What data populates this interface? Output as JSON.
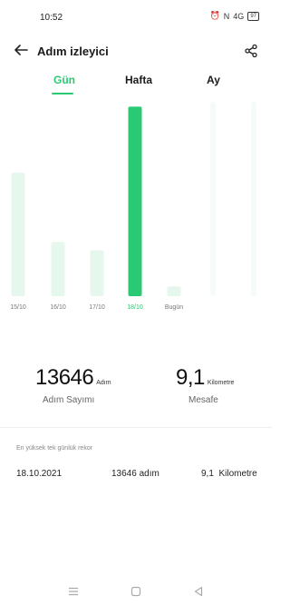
{
  "status_bar": {
    "time": "10:52",
    "battery": "97",
    "network": "N",
    "signal": "4G"
  },
  "header": {
    "title": "Adım izleyici",
    "back_icon": "arrow-left-icon",
    "share_icon": "share-icon"
  },
  "tabs": [
    {
      "label": "Gün",
      "active": true
    },
    {
      "label": "Hafta",
      "active": false
    },
    {
      "label": "Ay",
      "active": false
    }
  ],
  "colors": {
    "accent": "#2bc973",
    "bar_light": "#e6f7ed",
    "bar_faint": "#f6fbf8"
  },
  "chart_data": {
    "type": "bar",
    "categories": [
      "15/10",
      "16/10",
      "17/10",
      "18/10",
      "Bugün"
    ],
    "values": [
      8900,
      3900,
      3300,
      13646,
      700
    ],
    "highlight_index": 3,
    "ylim": [
      0,
      14000
    ]
  },
  "stats": {
    "steps_value": "13646",
    "steps_unit": "Adım",
    "steps_label": "Adım Sayımı",
    "distance_value": "9,1",
    "distance_unit": "Kilometre",
    "distance_label": "Mesafe"
  },
  "record": {
    "heading": "En yüksek tek günlük rekor",
    "date": "18.10.2021",
    "steps": "13646 adım",
    "distance": "9,1  Kilometre"
  },
  "nav_bar": {
    "menu_icon": "menu-icon",
    "home_icon": "home-icon",
    "back_icon": "back-triangle-icon"
  }
}
